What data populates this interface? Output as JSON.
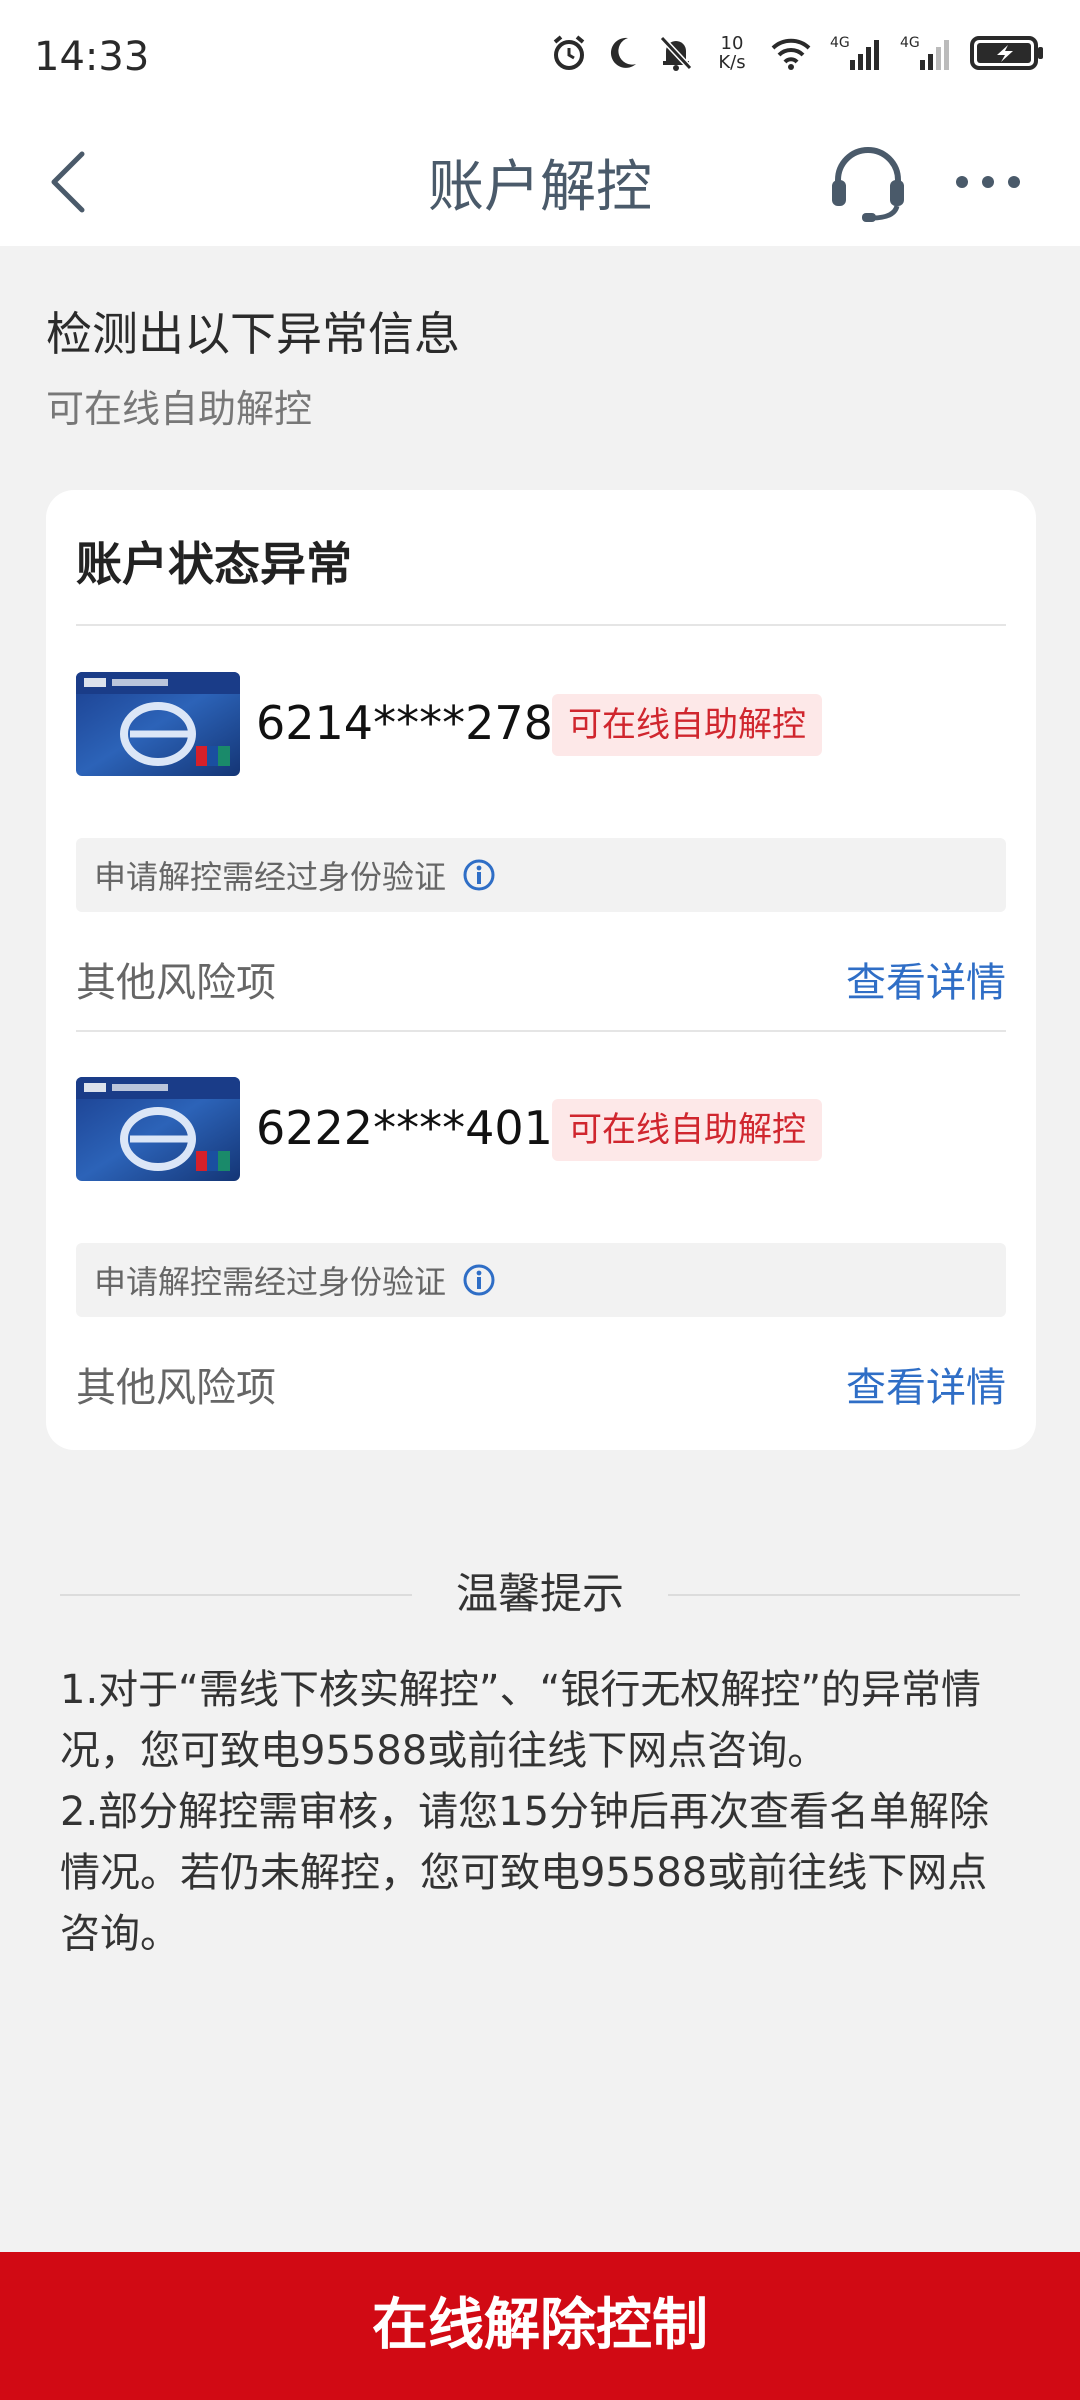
{
  "status_bar": {
    "time": "14:33",
    "net_speed_value": "10",
    "net_speed_unit": "K/s",
    "network1": "4G",
    "network2": "4G",
    "icons": [
      "alarm-icon",
      "moon-icon",
      "mute-icon",
      "wifi-icon",
      "signal-icon",
      "battery-icon"
    ]
  },
  "nav": {
    "title": "账户解控",
    "icons": [
      "back-arrow-icon",
      "headset-icon",
      "more-icon"
    ]
  },
  "intro": {
    "title": "检测出以下异常信息",
    "subtitle": "可在线自助解控"
  },
  "card": {
    "title": "账户状态异常",
    "accounts": [
      {
        "number": "6214****2780",
        "badge": "可在线自助解控",
        "verify_note": "申请解控需经过身份验证",
        "risk_label": "其他风险项",
        "details_link": "查看详情"
      },
      {
        "number": "6222****4011",
        "badge": "可在线自助解控",
        "verify_note": "申请解控需经过身份验证",
        "risk_label": "其他风险项",
        "details_link": "查看详情"
      }
    ]
  },
  "tips": {
    "title": "温馨提示",
    "items": [
      "1.对于“需线下核实解控”、“银行无权解控”的异常情况，您可致电95588或前往线下网点咨询。",
      "2.部分解控需审核，请您15分钟后再次查看名单解除情况。若仍未解控，您可致电95588或前往线下网点咨询。"
    ]
  },
  "bottom_button": {
    "label": "在线解除控制"
  },
  "colors": {
    "accent_red": "#d10a14",
    "link_blue": "#2f6ec6",
    "badge_bg": "#fde8e8",
    "badge_text": "#d0262e"
  }
}
